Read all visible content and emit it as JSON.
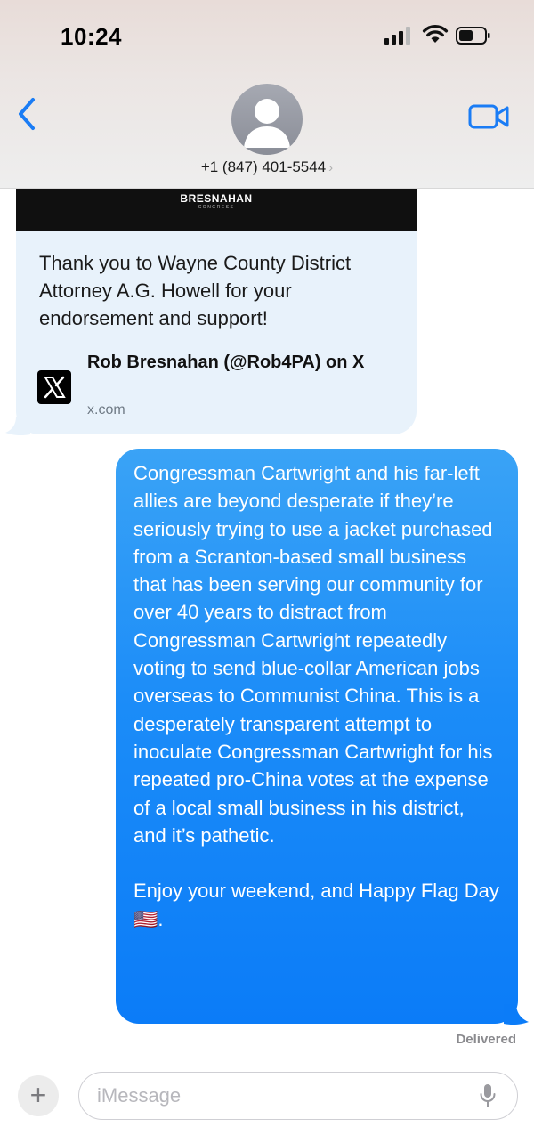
{
  "status_bar": {
    "time": "10:24"
  },
  "header": {
    "contact_number": "+1 (847) 401-5544",
    "chevron": "›",
    "icons": {
      "back": "chevron-left-icon",
      "video": "video-camera-icon",
      "avatar": "person-silhouette-icon"
    }
  },
  "incoming_message": {
    "banner_name": "BRESNAHAN",
    "banner_sub": "CONGRESS",
    "text": "Thank you to Wayne County District Attorney A.G. Howell for your endorsement and support!",
    "link_title": "Rob Bresnahan (@Rob4PA) on X",
    "link_domain": "x.com",
    "link_icon": "x-logo-icon"
  },
  "outgoing_message": {
    "paragraph_1": "Congressman Cartwright and his far-left allies are beyond desperate if they’re seriously trying to use a jacket purchased from a Scranton-based small business that has been serving our community for over 40 years to distract from Congressman Cartwright repeatedly voting to send blue-collar American jobs overseas to Communist China. This is a desperately transparent attempt to inoculate Congressman Cartwright for his repeated pro-China votes at the expense of a local small business in his district, and it’s pathetic.",
    "paragraph_2": "Enjoy your weekend, and Happy Flag Day 🇺🇸."
  },
  "delivery_status": "Delivered",
  "composer": {
    "plus_label": "+",
    "placeholder": "iMessage",
    "value": ""
  },
  "colors": {
    "outgoing_bubble": "#1b8cf8",
    "incoming_bubble": "#e8f2fb",
    "ios_blue": "#1a7cf5"
  }
}
